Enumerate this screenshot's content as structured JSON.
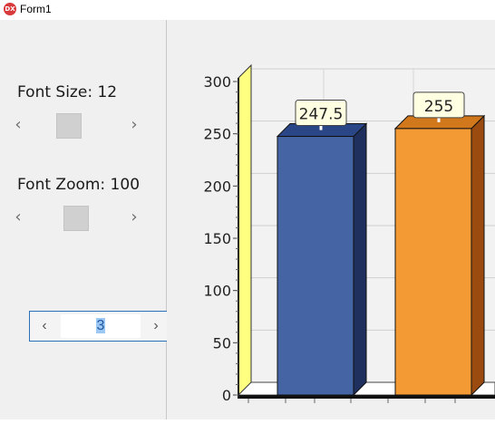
{
  "window": {
    "title": "Form1",
    "app_icon_text": "DX"
  },
  "controls": {
    "font_size_label": "Font Size: 12",
    "font_zoom_label": "Font Zoom: 100",
    "left_arrow": "‹",
    "right_arrow": "›",
    "spin_value": "3",
    "font_size_level": 0.5,
    "font_zoom_level": 0.5
  },
  "colors": {
    "bar_blue": "#4464a4",
    "bar_orange": "#f39a35",
    "side_wall": "#ffff80",
    "accent": "#2b6fb6"
  },
  "chart_data": {
    "type": "bar",
    "style": "3d",
    "categories": [
      "",
      ""
    ],
    "values": [
      247.5,
      255
    ],
    "data_labels": [
      "247.5",
      "255"
    ],
    "y_ticks": [
      "0",
      "50",
      "100",
      "150",
      "200",
      "250",
      "300"
    ],
    "ylim": [
      0,
      300
    ],
    "grid": true,
    "title": "",
    "xlabel": "",
    "ylabel": ""
  }
}
